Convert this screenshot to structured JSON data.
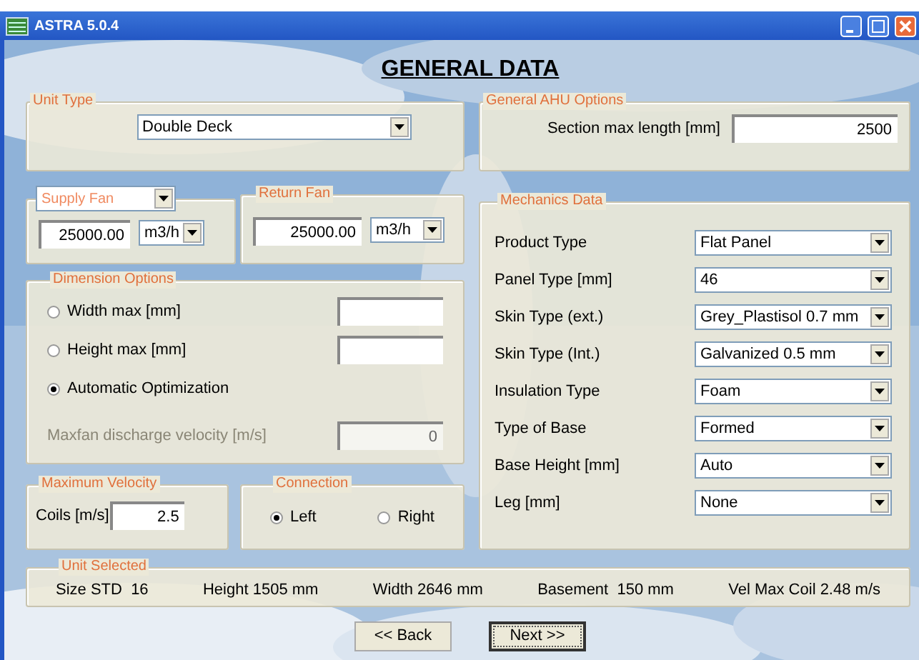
{
  "window": {
    "title": "ASTRA 5.0.4"
  },
  "heading": "GENERAL DATA",
  "unit_type": {
    "legend": "Unit Type",
    "value": "Double Deck"
  },
  "general_ahu": {
    "legend": "General AHU Options",
    "label": "Section max length [mm]",
    "value": "2500"
  },
  "supply_fan": {
    "legend": "Supply Fan",
    "value": "25000.00",
    "unit": "m3/h"
  },
  "return_fan": {
    "legend": "Return Fan",
    "value": "25000.00",
    "unit": "m3/h"
  },
  "dimension_options": {
    "legend": "Dimension Options",
    "options": [
      {
        "label": "Width max [mm]",
        "selected": false
      },
      {
        "label": "Height max [mm]",
        "selected": false
      },
      {
        "label": "Automatic Optimization",
        "selected": true
      }
    ],
    "discharge": {
      "label": "Maxfan discharge velocity [m/s]",
      "value": "0",
      "disabled": true
    }
  },
  "maximum_velocity": {
    "legend": "Maximum Velocity",
    "label": "Coils [m/s]",
    "value": "2.5"
  },
  "connection": {
    "legend": "Connection",
    "options": [
      {
        "label": "Left",
        "selected": true
      },
      {
        "label": "Right",
        "selected": false
      }
    ]
  },
  "mechanics": {
    "legend": "Mechanics Data",
    "rows": [
      {
        "label": "Product Type",
        "value": "Flat Panel"
      },
      {
        "label": "Panel Type [mm]",
        "value": "46"
      },
      {
        "label": "Skin Type (ext.)",
        "value": "Grey_Plastisol 0.7 mm"
      },
      {
        "label": "Skin Type (Int.)",
        "value": "Galvanized 0.5 mm"
      },
      {
        "label": "Insulation Type",
        "value": "Foam"
      },
      {
        "label": "Type of Base",
        "value": "Formed"
      },
      {
        "label": "Base Height [mm]",
        "value": "Auto"
      },
      {
        "label": "Leg [mm]",
        "value": "None"
      }
    ]
  },
  "unit_selected": {
    "legend": "Unit Selected",
    "items": [
      "Size STD  16",
      "Height 1505 mm",
      "Width 2646 mm",
      "Basement  150 mm",
      "Vel Max Coil 2.48 m/s"
    ]
  },
  "buttons": [
    {
      "label": "<< Back",
      "focused": false
    },
    {
      "label": "Next >>",
      "focused": true
    }
  ]
}
